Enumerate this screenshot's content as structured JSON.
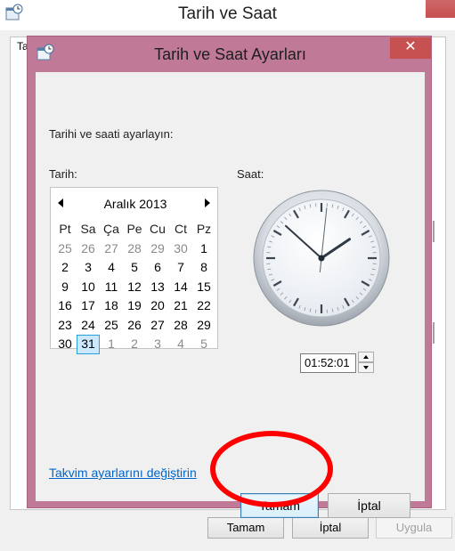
{
  "parent_window": {
    "title": "Tarih ve Saat",
    "tab_fragment": "Ta",
    "buttons": {
      "ok": "Tamam",
      "cancel": "İptal",
      "apply": "Uygula"
    }
  },
  "dialog": {
    "title": "Tarih ve Saat Ayarları",
    "close_glyph": "✕",
    "instruction": "Tarihi ve saati ayarlayın:",
    "date_label": "Tarih:",
    "time_label": "Saat:",
    "calendar": {
      "month_label": "Aralık 2013",
      "weekdays": [
        "Pt",
        "Sa",
        "Ça",
        "Pe",
        "Cu",
        "Ct",
        "Pz"
      ],
      "weeks": [
        [
          {
            "d": "25",
            "o": true
          },
          {
            "d": "26",
            "o": true
          },
          {
            "d": "27",
            "o": true
          },
          {
            "d": "28",
            "o": true
          },
          {
            "d": "29",
            "o": true
          },
          {
            "d": "30",
            "o": true
          },
          {
            "d": "1"
          }
        ],
        [
          {
            "d": "2"
          },
          {
            "d": "3"
          },
          {
            "d": "4"
          },
          {
            "d": "5"
          },
          {
            "d": "6"
          },
          {
            "d": "7"
          },
          {
            "d": "8"
          }
        ],
        [
          {
            "d": "9"
          },
          {
            "d": "10"
          },
          {
            "d": "11"
          },
          {
            "d": "12"
          },
          {
            "d": "13"
          },
          {
            "d": "14"
          },
          {
            "d": "15"
          }
        ],
        [
          {
            "d": "16"
          },
          {
            "d": "17"
          },
          {
            "d": "18"
          },
          {
            "d": "19"
          },
          {
            "d": "20"
          },
          {
            "d": "21"
          },
          {
            "d": "22"
          }
        ],
        [
          {
            "d": "23"
          },
          {
            "d": "24"
          },
          {
            "d": "25"
          },
          {
            "d": "26"
          },
          {
            "d": "27"
          },
          {
            "d": "28"
          },
          {
            "d": "29"
          }
        ],
        [
          {
            "d": "30"
          },
          {
            "d": "31",
            "today": true
          },
          {
            "d": "1",
            "o": true
          },
          {
            "d": "2",
            "o": true
          },
          {
            "d": "3",
            "o": true
          },
          {
            "d": "4",
            "o": true
          },
          {
            "d": "5",
            "o": true
          }
        ]
      ]
    },
    "clock": {
      "hours": 1,
      "minutes": 52,
      "seconds": 1
    },
    "time_value": "01:52:01",
    "calendar_settings_link": "Takvim ayarlarını değiştirin",
    "buttons": {
      "ok": "Tamam",
      "cancel": "İptal"
    }
  },
  "colors": {
    "dialog_frame": "#c07a98",
    "close_button": "#c75050",
    "link": "#0066cc",
    "annotation": "#ff0000",
    "today_highlight": "#cce8ff"
  },
  "icons": {
    "app_icon": "date-time-icon",
    "prev": "chevron-left-icon",
    "next": "chevron-right-icon"
  }
}
